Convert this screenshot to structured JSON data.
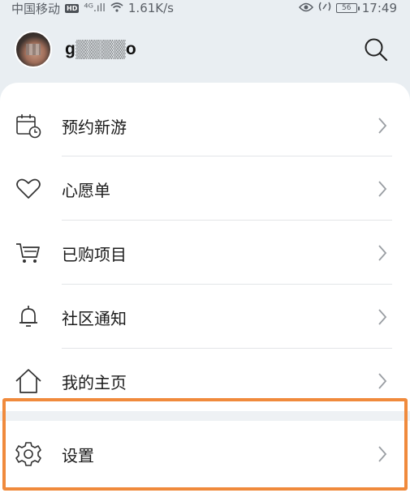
{
  "status_bar": {
    "carrier": "中国移动",
    "hd_badge": "HD",
    "signal": "⁴ᴳ.ıll",
    "wifi_icon": "wifi-icon",
    "speed": "1.61K/s",
    "eye_icon": "eye-icon",
    "battery": "56",
    "time": "17:49"
  },
  "header": {
    "username": "g▒▒▒▒o",
    "search_icon": "search-icon"
  },
  "menu": [
    {
      "label": "预约新游",
      "icon": "calendar-clock-icon"
    },
    {
      "label": "心愿单",
      "icon": "heart-icon"
    },
    {
      "label": "已购项目",
      "icon": "cart-icon"
    },
    {
      "label": "社区通知",
      "icon": "bell-icon"
    },
    {
      "label": "我的主页",
      "icon": "home-icon"
    },
    {
      "label": "设置",
      "icon": "gear-icon"
    }
  ],
  "colors": {
    "background": "#e9eef2",
    "card": "#ffffff",
    "highlight": "#f08a3c",
    "icon_stroke": "#333333",
    "chevron": "#9a9ea3"
  }
}
